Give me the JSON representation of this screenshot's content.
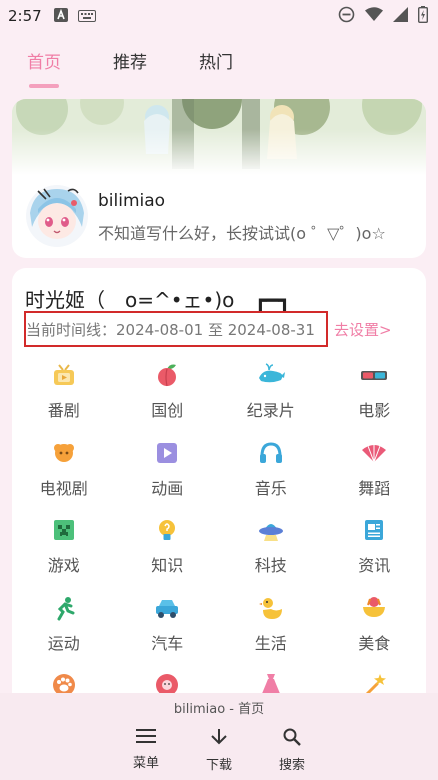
{
  "status_bar": {
    "time": "2:57",
    "icons": [
      "app-a-icon",
      "keyboard-icon",
      "do-not-disturb-icon",
      "wifi-icon",
      "signal-icon",
      "battery-icon"
    ]
  },
  "tabs": [
    {
      "label": "首页",
      "active": true
    },
    {
      "label": "推荐",
      "active": false
    },
    {
      "label": "热门",
      "active": false
    }
  ],
  "profile": {
    "username": "bilimiao",
    "signature": "不知道写什么好，长按试试(o ゜▽゜)o☆"
  },
  "main_card": {
    "title": "时光姬（　o=^•ェ•)o　┏━┓",
    "timeline_text": "当前时间线：2024-08-01 至 2024-08-31",
    "timeline_action": "去设置>"
  },
  "categories": [
    {
      "label": "番剧",
      "icon": "tv-icon"
    },
    {
      "label": "国创",
      "icon": "peach-icon"
    },
    {
      "label": "纪录片",
      "icon": "whale-icon"
    },
    {
      "label": "电影",
      "icon": "3d-glasses-icon"
    },
    {
      "label": "电视剧",
      "icon": "tv-series-icon"
    },
    {
      "label": "动画",
      "icon": "play-icon"
    },
    {
      "label": "音乐",
      "icon": "headphones-icon"
    },
    {
      "label": "舞蹈",
      "icon": "fan-icon"
    },
    {
      "label": "游戏",
      "icon": "creeper-icon"
    },
    {
      "label": "知识",
      "icon": "lightbulb-icon"
    },
    {
      "label": "科技",
      "icon": "ufo-icon"
    },
    {
      "label": "资讯",
      "icon": "news-icon"
    },
    {
      "label": "运动",
      "icon": "runner-icon"
    },
    {
      "label": "汽车",
      "icon": "car-icon"
    },
    {
      "label": "生活",
      "icon": "duck-icon"
    },
    {
      "label": "美食",
      "icon": "food-icon"
    },
    {
      "label": "",
      "icon": "paw-icon"
    },
    {
      "label": "",
      "icon": "flower-icon"
    },
    {
      "label": "",
      "icon": "dress-icon"
    },
    {
      "label": "",
      "icon": "magic-wand-icon"
    }
  ],
  "bottom_nav": {
    "caption": "bilimiao - 首页",
    "items": [
      {
        "label": "菜单",
        "icon": "menu-icon"
      },
      {
        "label": "下载",
        "icon": "download-icon"
      },
      {
        "label": "搜索",
        "icon": "search-icon"
      }
    ]
  }
}
